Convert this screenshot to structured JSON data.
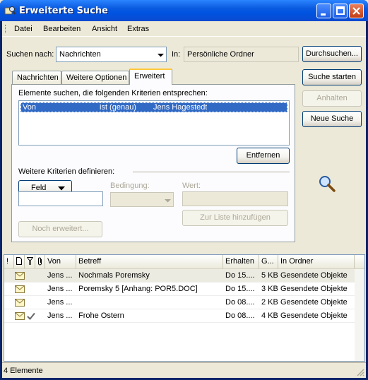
{
  "window": {
    "title": "Erweiterte Suche"
  },
  "menu": {
    "items": [
      {
        "label": "Datei"
      },
      {
        "label": "Bearbeiten"
      },
      {
        "label": "Ansicht"
      },
      {
        "label": "Extras"
      }
    ]
  },
  "search": {
    "look_for_label": "Suchen nach:",
    "look_for_value": "Nachrichten",
    "in_label": "In:",
    "in_value": "Persönliche Ordner",
    "browse_button": "Durchsuchen..."
  },
  "actions": {
    "start": "Suche starten",
    "stop": "Anhalten",
    "new": "Neue Suche"
  },
  "tabs": [
    {
      "label": "Nachrichten"
    },
    {
      "label": "Weitere Optionen"
    },
    {
      "label": "Erweitert"
    }
  ],
  "advanced": {
    "criteria_label": "Elemente suchen, die folgenden Kriterien entsprechen:",
    "criteria_rows": [
      {
        "field": "Von",
        "condition": "ist (genau)",
        "value": "Jens Hagestedt"
      }
    ],
    "remove_button": "Entfernen",
    "define_label": "Weitere Kriterien definieren:",
    "field_button": "Feld",
    "condition_label": "Bedingung:",
    "value_label": "Wert:",
    "add_button": "Zur Liste hinzufügen",
    "more_button": "Noch erweitert..."
  },
  "results": {
    "columns": {
      "importance": "!",
      "icon": "",
      "flag": "",
      "attach": "",
      "from": "Von",
      "subject": "Betreff",
      "received": "Erhalten",
      "size": "G...",
      "folder": "In Ordner"
    },
    "rows": [
      {
        "from": "Jens ...",
        "subject": "Nochmals Poremsky",
        "received": "Do 15....",
        "size": "5 KB",
        "folder": "Gesendete Objekte",
        "replied": false
      },
      {
        "from": "Jens ...",
        "subject": "Poremsky 5 [Anhang: POR5.DOC]",
        "received": "Do 15....",
        "size": "3 KB",
        "folder": "Gesendete Objekte",
        "replied": false
      },
      {
        "from": "Jens ...",
        "subject": "",
        "received": "Do 08....",
        "size": "2 KB",
        "folder": "Gesendete Objekte",
        "replied": false
      },
      {
        "from": "Jens ...",
        "subject": "Frohe Ostern",
        "received": "Do 08....",
        "size": "4 KB",
        "folder": "Gesendete Objekte",
        "replied": true
      }
    ]
  },
  "status": {
    "text": "4 Elemente"
  },
  "colors": {
    "title_bar": "#0a5adf",
    "selection": "#316ac5",
    "face": "#ece9d8"
  }
}
